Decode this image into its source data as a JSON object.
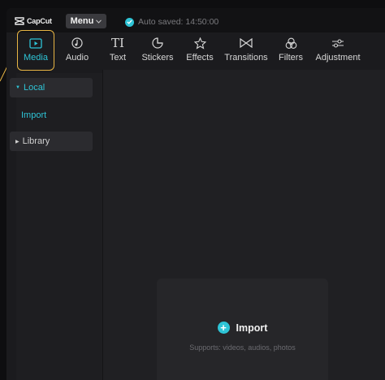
{
  "app": {
    "logo_text": "CapCut"
  },
  "titlebar": {
    "menu_label": "Menu",
    "autosave_text": "Auto saved: 14:50:00"
  },
  "toolbar": {
    "items": [
      {
        "label": "Media",
        "icon": "media-icon",
        "active": true
      },
      {
        "label": "Audio",
        "icon": "audio-icon"
      },
      {
        "label": "Text",
        "icon": "text-icon"
      },
      {
        "label": "Stickers",
        "icon": "stickers-icon"
      },
      {
        "label": "Effects",
        "icon": "effects-icon"
      },
      {
        "label": "Transitions",
        "icon": "transitions-icon"
      },
      {
        "label": "Filters",
        "icon": "filters-icon"
      },
      {
        "label": "Adjustment",
        "icon": "adjustment-icon"
      }
    ]
  },
  "sidebar": {
    "items": [
      {
        "label": "Local",
        "expanded": true
      },
      {
        "label": "Import"
      },
      {
        "label": "Library",
        "expanded": false
      }
    ]
  },
  "dropzone": {
    "button_label": "Import",
    "hint": "Supports: videos, audios, photos"
  },
  "colors": {
    "accent": "#2ec4d6",
    "highlight": "#e8b544",
    "background": "#1b1b1e"
  }
}
